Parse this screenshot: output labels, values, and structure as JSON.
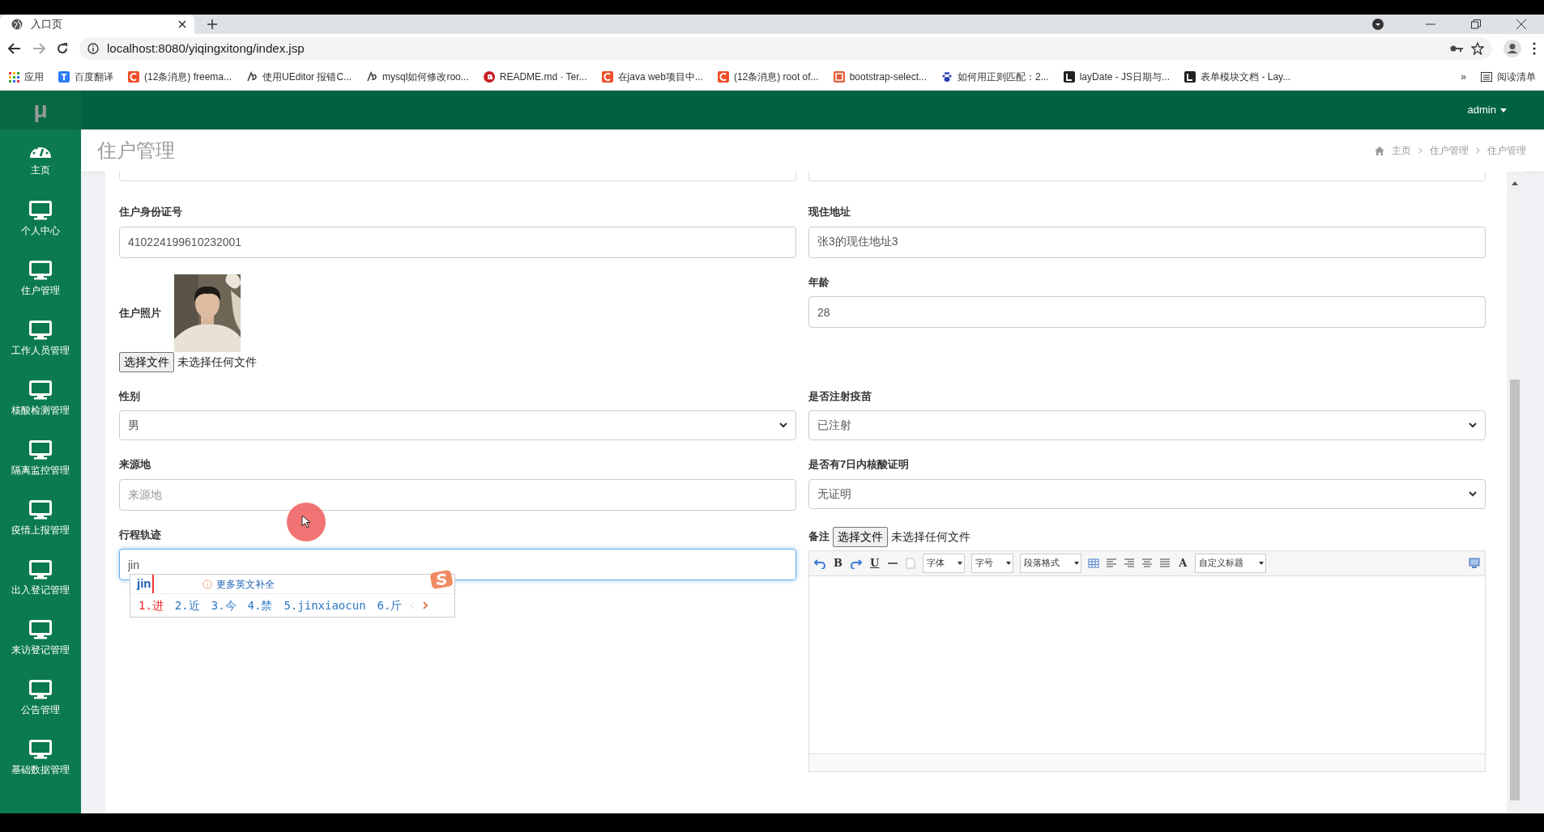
{
  "browser": {
    "tab": {
      "title": "入口页"
    },
    "url": "localhost:8080/yiqingxitong/index.jsp",
    "bookmarks": [
      {
        "label": "应用"
      },
      {
        "label": "百度翻译"
      },
      {
        "label": "(12条消息) freema..."
      },
      {
        "label": "使用UEditor 报错C..."
      },
      {
        "label": "mysql如何修改roo..."
      },
      {
        "label": "README.md · Ter..."
      },
      {
        "label": "在java web项目中..."
      },
      {
        "label": "(12条消息) root of..."
      },
      {
        "label": "bootstrap-select..."
      },
      {
        "label": "如何用正则匹配：2..."
      },
      {
        "label": "layDate - JS日期与..."
      },
      {
        "label": "表单模块文档 - Lay..."
      }
    ],
    "overflow": "»",
    "reading_list": "阅读清单"
  },
  "app": {
    "logo": "μ",
    "user": "admin",
    "sidebar": [
      {
        "label": "主页",
        "kind": "dashboard"
      },
      {
        "label": "个人中心",
        "kind": "monitor"
      },
      {
        "label": "住户管理",
        "kind": "monitor"
      },
      {
        "label": "工作人员管理",
        "kind": "monitor"
      },
      {
        "label": "核酸检测管理",
        "kind": "monitor"
      },
      {
        "label": "隔离监控管理",
        "kind": "monitor"
      },
      {
        "label": "疫情上报管理",
        "kind": "monitor"
      },
      {
        "label": "出入登记管理",
        "kind": "monitor"
      },
      {
        "label": "来访登记管理",
        "kind": "monitor"
      },
      {
        "label": "公告管理",
        "kind": "monitor"
      },
      {
        "label": "基础数据管理",
        "kind": "monitor"
      }
    ],
    "page_title": "住户管理",
    "breadcrumb": [
      "主页",
      "住户管理",
      "住户管理"
    ],
    "form": {
      "rows": [
        [
          {
            "label": "住户身份证号",
            "kind": "input",
            "value": "410224199610232001"
          },
          {
            "label": "现住地址",
            "kind": "input",
            "value": "张3的现住地址3"
          }
        ],
        [
          {
            "label": "住户照片",
            "button": "选择文件",
            "file_status": "未选择任何文件"
          },
          {
            "label": "年龄",
            "kind": "input",
            "value": "28"
          }
        ],
        [
          {
            "label": "性别",
            "kind": "select",
            "value": "男"
          },
          {
            "label": "是否注射疫苗",
            "kind": "select",
            "value": "已注射"
          }
        ],
        [
          {
            "label": "来源地",
            "kind": "input",
            "placeholder": "来源地"
          },
          {
            "label": "是否有7日内核酸证明",
            "kind": "select",
            "value": "无证明"
          }
        ],
        [
          {
            "label": "行程轨迹",
            "kind": "input",
            "value": "jin",
            "focused": true
          },
          {
            "label": "备注",
            "kind": "editor",
            "button": "选择文件",
            "file_status": "未选择任何文件",
            "toolbar": [
              {
                "kind": "icon"
              },
              {
                "kind": "glyph",
                "label": "B"
              },
              {
                "kind": "icon"
              },
              {
                "kind": "glyph",
                "label": "U"
              },
              {
                "kind": "icon"
              },
              {
                "kind": "icon"
              },
              {
                "kind": "dropdown",
                "label": "字体"
              },
              {
                "kind": "dropdown",
                "label": "字号"
              },
              {
                "kind": "dropdown",
                "label": "段落格式"
              },
              {
                "kind": "icon"
              },
              {
                "kind": "icon"
              },
              {
                "kind": "icon"
              },
              {
                "kind": "icon"
              },
              {
                "kind": "icon"
              },
              {
                "kind": "glyph",
                "label": "A"
              },
              {
                "kind": "dropdown",
                "label": "自定义标题"
              }
            ]
          }
        ]
      ]
    }
  },
  "ime": {
    "composition": "jin",
    "hint": "更多英文补全",
    "candidates": [
      {
        "label": "1.进",
        "selected": true
      },
      {
        "label": "2.近",
        "selected": false
      },
      {
        "label": "3.今",
        "selected": false
      },
      {
        "label": "4.禁",
        "selected": false
      },
      {
        "label": "5.jinxiaocun",
        "selected": false
      },
      {
        "label": "6.斤",
        "selected": false
      }
    ]
  }
}
